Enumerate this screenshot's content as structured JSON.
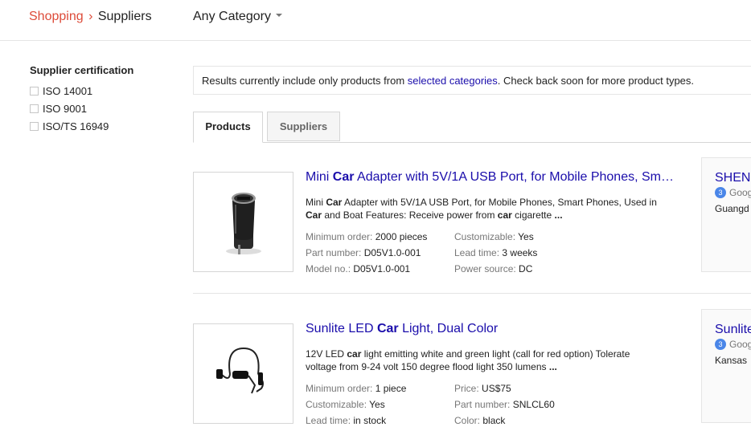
{
  "header": {
    "breadcrumb_home": "Shopping",
    "breadcrumb_sep": "›",
    "breadcrumb_current": "Suppliers",
    "category_label": "Any Category"
  },
  "filters": {
    "title": "Supplier certification",
    "options": [
      "ISO 14001",
      "ISO 9001",
      "ISO/TS 16949"
    ]
  },
  "notice": {
    "before": "Results currently include only products from ",
    "link": "selected categories",
    "after": ". Check back soon for more product types."
  },
  "tabs": [
    {
      "label": "Products",
      "active": true
    },
    {
      "label": "Suppliers",
      "active": false
    }
  ],
  "results": [
    {
      "title_pre": "Mini ",
      "title_bold": "Car",
      "title_post": " Adapter with 5V/1A USB Port, for Mobile Phones, Sm…",
      "desc_a": "Mini ",
      "desc_b": "Car",
      "desc_c": " Adapter with 5V/1A USB Port, for Mobile Phones, Smart Phones, Used in ",
      "desc_d": "Car",
      "desc_e": " and Boat Features: Receive power from ",
      "desc_f": "car",
      "desc_g": " cigarette ",
      "desc_more": "...",
      "attrs_left": [
        {
          "k": "Minimum order:",
          "v": "2000 pieces"
        },
        {
          "k": "Part number:",
          "v": "D05V1.0-001"
        },
        {
          "k": "Model no.:",
          "v": "D05V1.0-001"
        }
      ],
      "attrs_right": [
        {
          "k": "Customizable:",
          "v": "Yes"
        },
        {
          "k": "Lead time:",
          "v": "3 weeks"
        },
        {
          "k": "Power source:",
          "v": "DC"
        }
      ],
      "supplier": {
        "name": "SHEN",
        "badge": "Goog",
        "badge_num": "3",
        "location": "Guangd"
      }
    },
    {
      "title_pre": "Sunlite LED ",
      "title_bold": "Car",
      "title_post": " Light, Dual Color",
      "desc_a": "12V LED ",
      "desc_b": "car",
      "desc_c": " light emitting white and green light (call for red option) Tolerate voltage from 9-24 volt 150 degree flood light 350 lumens ",
      "desc_d": "",
      "desc_e": "",
      "desc_f": "",
      "desc_g": "",
      "desc_more": "...",
      "attrs_left": [
        {
          "k": "Minimum order:",
          "v": "1 piece"
        },
        {
          "k": "Customizable:",
          "v": "Yes"
        },
        {
          "k": "Lead time:",
          "v": "in stock"
        }
      ],
      "attrs_right": [
        {
          "k": "Price:",
          "v": "US$75"
        },
        {
          "k": "Part number:",
          "v": "SNLCL60"
        },
        {
          "k": "Color:",
          "v": "black"
        }
      ],
      "supplier": {
        "name": "Sunlite",
        "badge": "Goog",
        "badge_num": "3",
        "location": "Kansas"
      }
    }
  ]
}
